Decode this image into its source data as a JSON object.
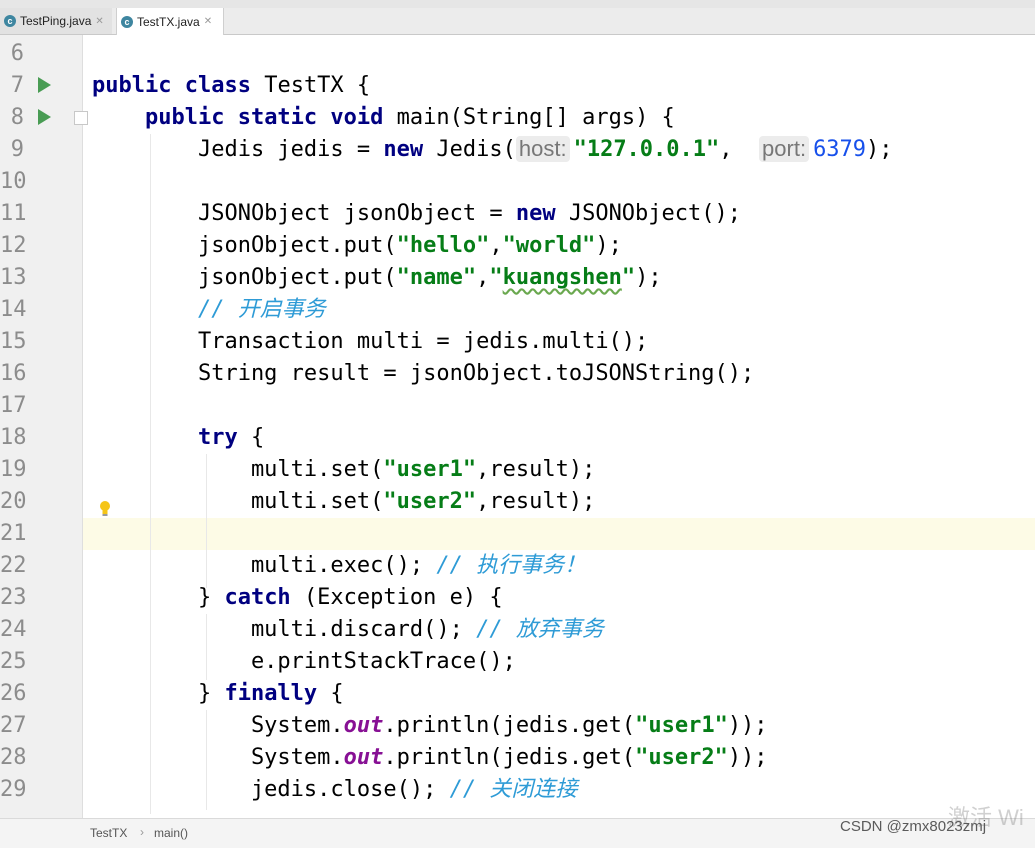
{
  "tabs": [
    {
      "label": "TestPing.java",
      "active": false
    },
    {
      "label": "TestTX.java",
      "active": true
    }
  ],
  "editor": {
    "caret_line": 21,
    "lines": [
      {
        "n": "6",
        "tokens": []
      },
      {
        "n": "7",
        "tokens": [
          {
            "t": "kw",
            "v": "public "
          },
          {
            "t": "kw",
            "v": "class "
          },
          {
            "t": "",
            "v": "TestTX {"
          }
        ]
      },
      {
        "n": "8",
        "tokens": [
          {
            "t": "",
            "v": "    "
          },
          {
            "t": "kw",
            "v": "public static void "
          },
          {
            "t": "",
            "v": "main(String[] args) {"
          }
        ]
      },
      {
        "n": "9",
        "tokens": [
          {
            "t": "",
            "v": "        Jedis jedis = "
          },
          {
            "t": "kw",
            "v": "new "
          },
          {
            "t": "",
            "v": "Jedis("
          },
          {
            "t": "hint",
            "v": "host:"
          },
          {
            "t": "str",
            "v": "\"127.0.0.1\""
          },
          {
            "t": "",
            "v": ",  "
          },
          {
            "t": "hint",
            "v": "port:"
          },
          {
            "t": "num",
            "v": "6379"
          },
          {
            "t": "",
            "v": ");"
          }
        ]
      },
      {
        "n": "10",
        "tokens": []
      },
      {
        "n": "11",
        "tokens": [
          {
            "t": "",
            "v": "        JSONObject jsonObject = "
          },
          {
            "t": "kw",
            "v": "new "
          },
          {
            "t": "",
            "v": "JSONObject();"
          }
        ]
      },
      {
        "n": "12",
        "tokens": [
          {
            "t": "",
            "v": "        jsonObject.put("
          },
          {
            "t": "str",
            "v": "\"hello\""
          },
          {
            "t": "",
            "v": ","
          },
          {
            "t": "str",
            "v": "\"world\""
          },
          {
            "t": "",
            "v": ");"
          }
        ]
      },
      {
        "n": "13",
        "tokens": [
          {
            "t": "",
            "v": "        jsonObject.put("
          },
          {
            "t": "str",
            "v": "\"name\""
          },
          {
            "t": "",
            "v": ","
          },
          {
            "t": "str",
            "v": "\""
          },
          {
            "t": "strsq",
            "v": "kuangshen"
          },
          {
            "t": "str",
            "v": "\""
          },
          {
            "t": "",
            "v": ");"
          }
        ]
      },
      {
        "n": "14",
        "tokens": [
          {
            "t": "",
            "v": "        "
          },
          {
            "t": "cm",
            "v": "// 开启事务"
          }
        ]
      },
      {
        "n": "15",
        "tokens": [
          {
            "t": "",
            "v": "        Transaction multi = jedis.multi();"
          }
        ]
      },
      {
        "n": "16",
        "tokens": [
          {
            "t": "",
            "v": "        String result = jsonObject.toJSONString();"
          }
        ]
      },
      {
        "n": "17",
        "tokens": []
      },
      {
        "n": "18",
        "tokens": [
          {
            "t": "",
            "v": "        "
          },
          {
            "t": "kw",
            "v": "try "
          },
          {
            "t": "",
            "v": "{"
          }
        ]
      },
      {
        "n": "19",
        "tokens": [
          {
            "t": "",
            "v": "            multi.set("
          },
          {
            "t": "str",
            "v": "\"user1\""
          },
          {
            "t": "",
            "v": ",result);"
          }
        ]
      },
      {
        "n": "20",
        "tokens": [
          {
            "t": "",
            "v": "            multi.set("
          },
          {
            "t": "str",
            "v": "\"user2\""
          },
          {
            "t": "",
            "v": ",result);"
          }
        ]
      },
      {
        "n": "21",
        "tokens": []
      },
      {
        "n": "22",
        "tokens": [
          {
            "t": "",
            "v": "            multi.exec(); "
          },
          {
            "t": "cm",
            "v": "// 执行事务！"
          }
        ]
      },
      {
        "n": "23",
        "tokens": [
          {
            "t": "",
            "v": "        } "
          },
          {
            "t": "kw",
            "v": "catch "
          },
          {
            "t": "",
            "v": "(Exception e) {"
          }
        ]
      },
      {
        "n": "24",
        "tokens": [
          {
            "t": "",
            "v": "            multi.discard(); "
          },
          {
            "t": "cm",
            "v": "// 放弃事务"
          }
        ]
      },
      {
        "n": "25",
        "tokens": [
          {
            "t": "",
            "v": "            e.printStackTrace();"
          }
        ]
      },
      {
        "n": "26",
        "tokens": [
          {
            "t": "",
            "v": "        } "
          },
          {
            "t": "kw",
            "v": "finally "
          },
          {
            "t": "",
            "v": "{"
          }
        ]
      },
      {
        "n": "27",
        "tokens": [
          {
            "t": "",
            "v": "            System."
          },
          {
            "t": "fld",
            "v": "out"
          },
          {
            "t": "",
            "v": ".println(jedis.get("
          },
          {
            "t": "str",
            "v": "\"user1\""
          },
          {
            "t": "",
            "v": "));"
          }
        ]
      },
      {
        "n": "28",
        "tokens": [
          {
            "t": "",
            "v": "            System."
          },
          {
            "t": "fld",
            "v": "out"
          },
          {
            "t": "",
            "v": ".println(jedis.get("
          },
          {
            "t": "str",
            "v": "\"user2\""
          },
          {
            "t": "",
            "v": "));"
          }
        ]
      },
      {
        "n": "29",
        "tokens": [
          {
            "t": "",
            "v": "            jedis.close(); "
          },
          {
            "t": "cm",
            "v": "// 关闭连接"
          }
        ]
      }
    ]
  },
  "icons": {
    "run": "run-gutter-icon",
    "fold": "fold-icon",
    "bulb": "lightbulb-icon"
  },
  "breadcrumb": {
    "class_name": "TestTX",
    "method": "main()"
  },
  "watermark": {
    "activation": "激活 Wi",
    "csdn": "CSDN @zmx8023zmj"
  }
}
